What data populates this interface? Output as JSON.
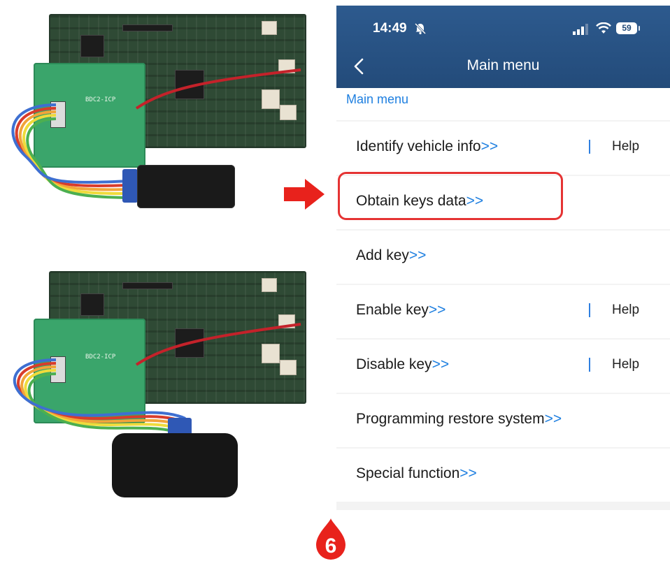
{
  "phone": {
    "status_time": "14:49",
    "battery": "59",
    "title": "Main menu",
    "breadcrumb": "Main menu",
    "chevron": ">>",
    "help_label": "Help",
    "menu_items": [
      {
        "label": "Identify vehicle info",
        "has_help": true
      },
      {
        "label": "Obtain keys data",
        "has_help": false,
        "highlighted": true
      },
      {
        "label": "Add key",
        "has_help": false
      },
      {
        "label": "Enable key",
        "has_help": true
      },
      {
        "label": "Disable key",
        "has_help": true
      },
      {
        "label": "Programming restore system",
        "has_help": false
      },
      {
        "label": "Special function",
        "has_help": false
      }
    ]
  },
  "photos": {
    "adapter_label": "BDC2-ICP"
  },
  "step_badge": "6",
  "colors": {
    "header_blue": "#234b7a",
    "link_blue": "#1e7fe0",
    "highlight_red": "#e53333",
    "arrow_red": "#e8221c"
  }
}
